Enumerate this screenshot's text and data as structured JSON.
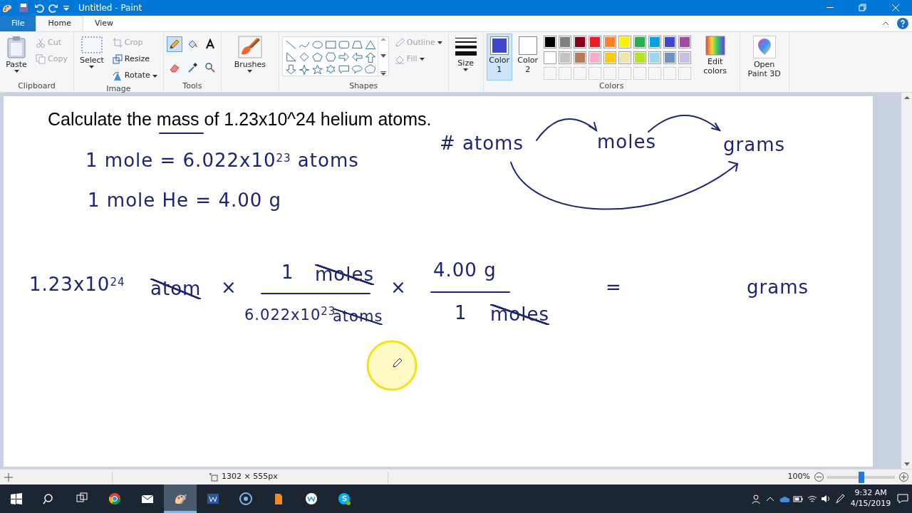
{
  "window": {
    "title": "Untitled - Paint"
  },
  "tabs": [
    {
      "label": "File",
      "kind": "file",
      "selected": false
    },
    {
      "label": "Home",
      "kind": "tab",
      "selected": true
    },
    {
      "label": "View",
      "kind": "tab",
      "selected": false
    }
  ],
  "ribbon": [
    {
      "label": "Clipboard",
      "items": [
        {
          "kind": "large",
          "label": "Paste",
          "dropdown": true,
          "disabled": false
        },
        {
          "kind": "small",
          "label": "Cut",
          "dropdown": false,
          "disabled": true
        },
        {
          "kind": "small",
          "label": "Copy",
          "dropdown": false,
          "disabled": true
        }
      ]
    },
    {
      "label": "Image",
      "items": [
        {
          "kind": "large",
          "label": "Select",
          "dropdown": true,
          "disabled": false
        },
        {
          "kind": "small",
          "label": "Crop",
          "dropdown": false,
          "disabled": true
        },
        {
          "kind": "small",
          "label": "Resize",
          "dropdown": false,
          "disabled": false
        },
        {
          "kind": "small",
          "label": "Rotate",
          "dropdown": true,
          "disabled": false
        }
      ]
    },
    {
      "label": "Tools",
      "items": [
        {
          "kind": "tools",
          "tools": [
            {
              "selected": true
            },
            {
              "selected": false
            },
            {
              "selected": false
            },
            {
              "selected": false
            },
            {
              "selected": false
            },
            {
              "selected": false
            }
          ]
        }
      ]
    },
    {
      "items": [
        {
          "kind": "large",
          "label": "Brushes",
          "dropdown": true,
          "disabled": false
        }
      ]
    },
    {
      "label": "Shapes",
      "items": [
        {
          "kind": "gallery"
        },
        {
          "kind": "small",
          "label": "Outline",
          "dropdown": true,
          "disabled": true
        },
        {
          "kind": "small",
          "label": "Fill",
          "dropdown": true,
          "disabled": true
        }
      ]
    },
    {
      "items": [
        {
          "kind": "large",
          "label": "Size",
          "dropdown": true,
          "disabled": false
        }
      ]
    },
    {
      "label": "Colors",
      "items": [
        {
          "kind": "swatch",
          "label": "Color 1",
          "color": "#3f48cc",
          "selected": true
        },
        {
          "kind": "swatch",
          "label": "Color 2",
          "color": "#ffffff",
          "selected": false
        },
        {
          "kind": "palette",
          "colors": [
            {
              "color": "#000000"
            },
            {
              "color": "#7f7f7f"
            },
            {
              "color": "#880015"
            },
            {
              "color": "#ed1c24"
            },
            {
              "color": "#ff7f27"
            },
            {
              "color": "#fff200"
            },
            {
              "color": "#22b14c"
            },
            {
              "color": "#00a2e8"
            },
            {
              "color": "#3f48cc"
            },
            {
              "color": "#a349a4"
            },
            {
              "color": "#ffffff"
            },
            {
              "color": "#c3c3c3"
            },
            {
              "color": "#b97a57"
            },
            {
              "color": "#ffaec9"
            },
            {
              "color": "#ffc90e"
            },
            {
              "color": "#efe4b0"
            },
            {
              "color": "#b5e61d"
            },
            {
              "color": "#99d9ea"
            },
            {
              "color": "#7092be"
            },
            {
              "color": "#c8bfe7"
            }
          ]
        },
        {
          "kind": "large",
          "label": "Edit colors",
          "dropdown": false,
          "disabled": false
        }
      ]
    },
    {
      "items": [
        {
          "kind": "large",
          "label": "Open Paint 3D",
          "dropdown": false,
          "disabled": false
        }
      ]
    }
  ],
  "canvas": {
    "heading": "Calculate the mass of 1.23x10^24 helium atoms.",
    "notes": [
      {
        "text": "1 mole = 6.022x10$^{23}$ atoms",
        "cancelled": false
      },
      {
        "text": "1 mole He = 4.00 g",
        "cancelled": false
      },
      {
        "text": "# atoms",
        "cancelled": false
      },
      {
        "text": "moles",
        "cancelled": false
      },
      {
        "text": "grams",
        "cancelled": false
      },
      {
        "text": "1.23x10$^{24}$",
        "cancelled": false
      },
      {
        "text": "atom",
        "cancelled": true
      },
      {
        "text": "×",
        "cancelled": false
      },
      {
        "text": "1",
        "cancelled": false
      },
      {
        "text": "moles",
        "cancelled": true
      },
      {
        "text": "6.022x10$^{23}$",
        "cancelled": false
      },
      {
        "text": "atoms",
        "cancelled": true
      },
      {
        "text": "×",
        "cancelled": false
      },
      {
        "text": "4.00 g",
        "cancelled": false
      },
      {
        "text": "1",
        "cancelled": false
      },
      {
        "text": "moles",
        "cancelled": true
      },
      {
        "text": "=",
        "cancelled": false
      },
      {
        "text": "grams",
        "cancelled": false
      }
    ]
  },
  "status_bar": {
    "dimensions": "1302 × 555px",
    "zoom": {
      "label": "100%",
      "level": 0.5
    }
  },
  "taskbar": {
    "apps": [
      {
        "active": false
      },
      {
        "active": false
      },
      {
        "active": true
      },
      {
        "active": false
      },
      {
        "active": false
      },
      {
        "active": false
      },
      {
        "active": false
      },
      {
        "active": false
      }
    ],
    "clock": {
      "time": "9:32 AM",
      "date": "4/15/2019"
    }
  }
}
